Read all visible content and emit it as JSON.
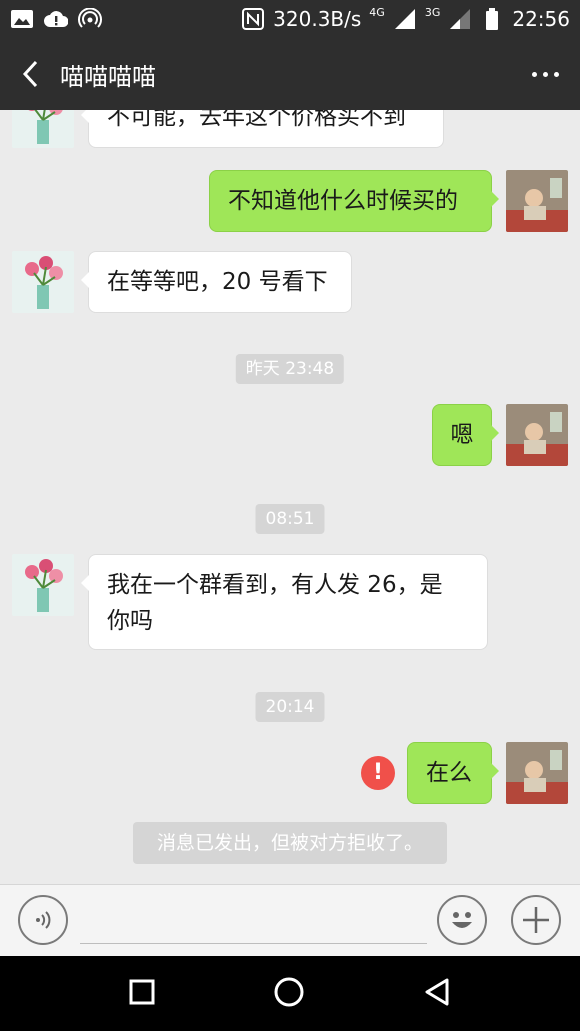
{
  "status_bar": {
    "net_speed": "320.3B/s",
    "signal1_label": "4G",
    "signal2_label": "3G",
    "time": "22:56",
    "icons": [
      "image-icon",
      "cloud-alert-icon",
      "hotspot-icon",
      "nfc-icon",
      "signal-icon",
      "battery-icon"
    ]
  },
  "header": {
    "title": "喵喵喵喵",
    "back_icon": "chevron-left-icon",
    "more_icon": "more-dots-icon"
  },
  "messages": [
    {
      "side": "in",
      "text": "不可能，去年这个价格买不到"
    },
    {
      "side": "out",
      "text": "不知道他什么时候买的"
    },
    {
      "side": "in",
      "text": "在等等吧，20 号看下"
    },
    {
      "type": "time",
      "text": "昨天 23:48"
    },
    {
      "side": "out",
      "text": "嗯"
    },
    {
      "type": "time",
      "text": "08:51"
    },
    {
      "side": "in",
      "text_line1": "我在一个群看到，有人发 26，是",
      "text_line2": "你吗"
    },
    {
      "type": "time",
      "text": "20:14"
    },
    {
      "side": "out",
      "text": "在么",
      "failed": true,
      "error_mark": "!"
    }
  ],
  "notice": "消息已发出，但被对方拒收了。",
  "input_bar": {
    "voice_icon": "voice-icon",
    "emoji_icon": "emoji-icon",
    "plus_icon": "plus-icon"
  },
  "nav_bar": {
    "icons": [
      "square-recent-icon",
      "circle-home-icon",
      "triangle-back-icon"
    ]
  },
  "colors": {
    "header_bg": "#2e2e2e",
    "chat_bg": "#ebebeb",
    "out_bubble": "#9fe658",
    "in_bubble": "#ffffff",
    "error": "#f0504a"
  }
}
